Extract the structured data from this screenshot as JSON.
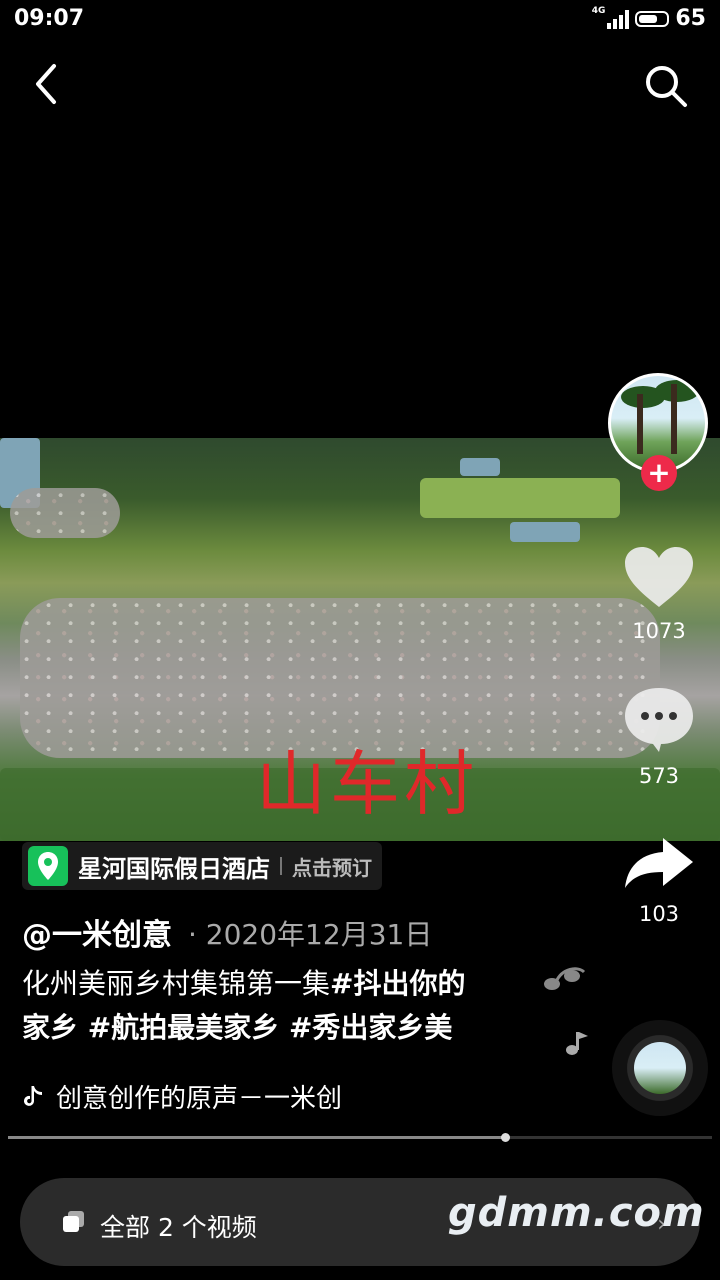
{
  "status_bar": {
    "time": "09:07",
    "network": "4G",
    "battery": "65"
  },
  "nav": {
    "back_icon": "back-arrow-icon",
    "search_icon": "search-icon"
  },
  "video": {
    "overlay_text": "山车村"
  },
  "actions": {
    "likes": "1073",
    "comments": "573",
    "shares": "103"
  },
  "poi": {
    "name": "星河国际假日酒店",
    "action": "点击预订"
  },
  "post": {
    "author": "@一米创意",
    "date": "· 2020年12月31日",
    "text": "化州美丽乡村集锦第一集",
    "tags_line1": "#抖出你的",
    "tags_line2": "家乡 #航拍最美家乡 #秀出家乡美"
  },
  "music": {
    "title": "创意创作的原声－一米创"
  },
  "progress": {
    "fraction": 0.705
  },
  "collection": {
    "label": "全部 2 个视频",
    "arrow": "›"
  },
  "watermark": "gdmm.com",
  "colors": {
    "follow": "#ee2a4a",
    "poi_pin": "#17c15a",
    "overlay_text": "#e0282a"
  }
}
